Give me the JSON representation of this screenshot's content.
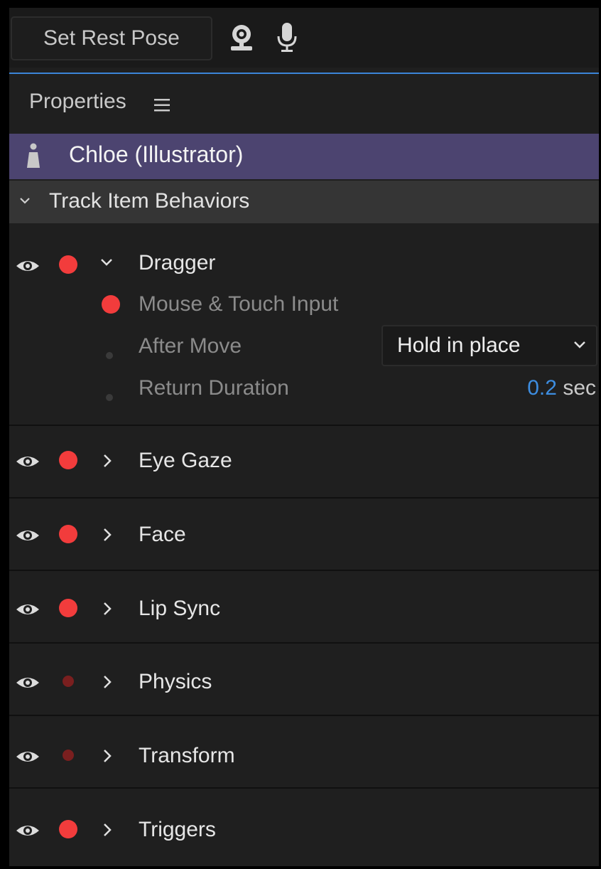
{
  "toolbar": {
    "rest_pose_label": "Set Rest Pose",
    "camera_icon": "webcam-icon",
    "mic_icon": "microphone-icon"
  },
  "panel": {
    "title": "Properties",
    "menu_icon": "hamburger-menu-icon"
  },
  "puppet": {
    "name": "Chloe (Illustrator)",
    "icon": "puppet-icon"
  },
  "section": {
    "label": "Track Item Behaviors",
    "expanded": true
  },
  "dragger": {
    "label": "Dragger",
    "expanded": true,
    "params": {
      "mouse_input": "Mouse & Touch Input",
      "after_move": "After Move",
      "after_move_value": "Hold in place",
      "return_duration": "Return Duration",
      "return_duration_value": "0.2",
      "return_duration_unit": "sec"
    }
  },
  "behaviors": [
    {
      "label": "Eye Gaze",
      "armed": true
    },
    {
      "label": "Face",
      "armed": true
    },
    {
      "label": "Lip Sync",
      "armed": true
    },
    {
      "label": "Physics",
      "armed": false
    },
    {
      "label": "Transform",
      "armed": false
    },
    {
      "label": "Triggers",
      "armed": true
    }
  ],
  "colors": {
    "armed_dot": "#f23c3c",
    "disarmed_dot": "#7a1f1f",
    "puppet_bar": "#4c4470",
    "accent": "#3b84d8",
    "value_blue": "#3d8de0"
  }
}
